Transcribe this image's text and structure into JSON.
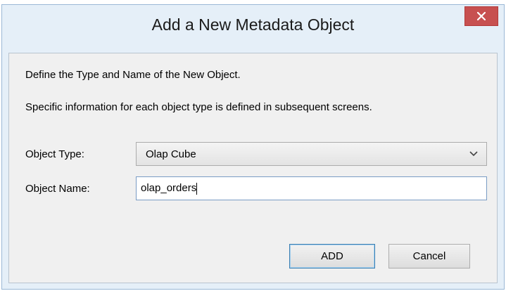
{
  "dialog": {
    "title": "Add a New Metadata Object",
    "intro_line1": "Define the Type and Name of the New Object.",
    "intro_line2": "Specific information for each object type is defined in subsequent screens.",
    "object_type_label": "Object Type:",
    "object_type_value": "Olap Cube",
    "object_name_label": "Object Name:",
    "object_name_value": "olap_orders",
    "add_label": "ADD",
    "cancel_label": "Cancel"
  },
  "icons": {
    "close": "close-icon",
    "dropdown": "chevron-down-icon"
  },
  "colors": {
    "window_frame": "#e5eff8",
    "close_button": "#c75050",
    "client_area": "#f0f0f0"
  }
}
